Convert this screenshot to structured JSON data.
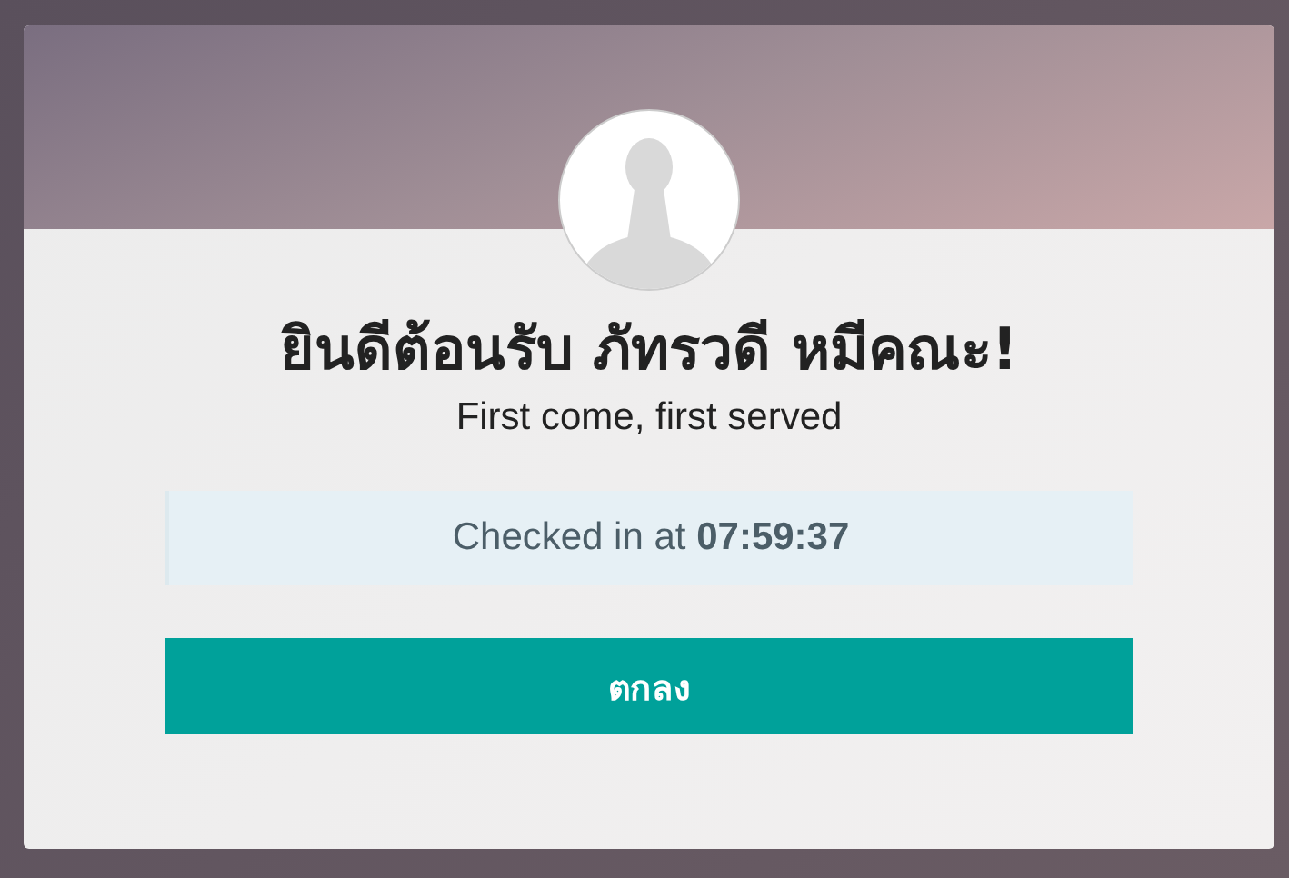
{
  "greeting": "ยินดีต้อนรับ ภัทรวดี หมีคณะ!",
  "subtitle": "First come, first served",
  "status": "Checked in at **07:59:37**",
  "button": "ตกลง"
}
